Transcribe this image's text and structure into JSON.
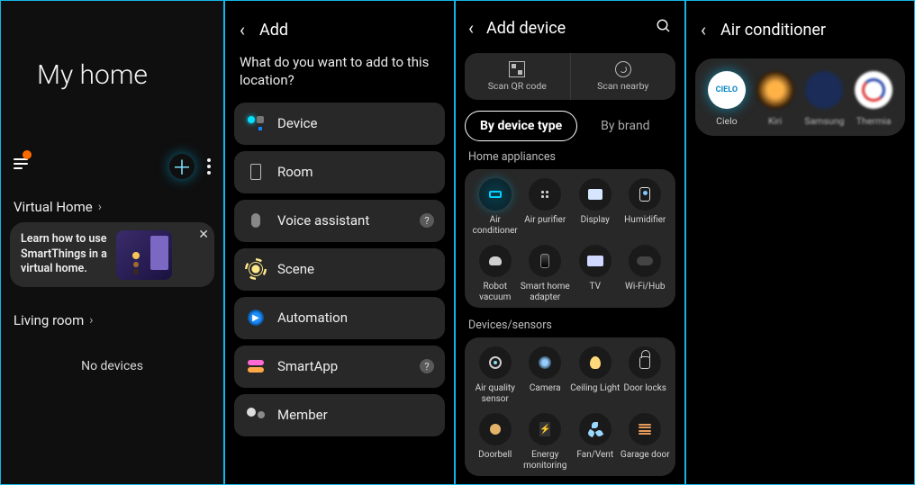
{
  "panel1": {
    "title": "My home",
    "virtual_home": "Virtual Home",
    "tip_line1": "Learn how to use",
    "tip_line2": "SmartThings in a",
    "tip_line3": "virtual home.",
    "living_room": "Living room",
    "no_devices": "No devices"
  },
  "panel2": {
    "title": "Add",
    "prompt": "What do you want to add to this location?",
    "items": [
      {
        "label": "Device"
      },
      {
        "label": "Room"
      },
      {
        "label": "Voice assistant",
        "help": true
      },
      {
        "label": "Scene"
      },
      {
        "label": "Automation"
      },
      {
        "label": "SmartApp",
        "help": true
      },
      {
        "label": "Member"
      }
    ]
  },
  "panel3": {
    "title": "Add device",
    "scan_qr": "Scan QR code",
    "scan_nearby": "Scan nearby",
    "tab_type": "By device type",
    "tab_brand": "By brand",
    "cat_home": "Home appliances",
    "cat_sensors": "Devices/sensors",
    "home_tiles": [
      {
        "label": "Air conditioner"
      },
      {
        "label": "Air purifier"
      },
      {
        "label": "Display"
      },
      {
        "label": "Humidifier"
      },
      {
        "label": "Robot vacuum"
      },
      {
        "label": "Smart home adapter"
      },
      {
        "label": "TV"
      },
      {
        "label": "Wi-Fi/Hub"
      }
    ],
    "sensor_tiles": [
      {
        "label": "Air quality sensor"
      },
      {
        "label": "Camera"
      },
      {
        "label": "Ceiling Light"
      },
      {
        "label": "Door locks"
      },
      {
        "label": "Doorbell"
      },
      {
        "label": "Energy monitoring"
      },
      {
        "label": "Fan/Vent"
      },
      {
        "label": "Garage door"
      }
    ]
  },
  "panel4": {
    "title": "Air conditioner",
    "brands": [
      {
        "label": "Cielo",
        "logo": "CIELO"
      },
      {
        "label": "Kiri"
      },
      {
        "label": "Samsung"
      },
      {
        "label": "Thermia"
      }
    ]
  }
}
